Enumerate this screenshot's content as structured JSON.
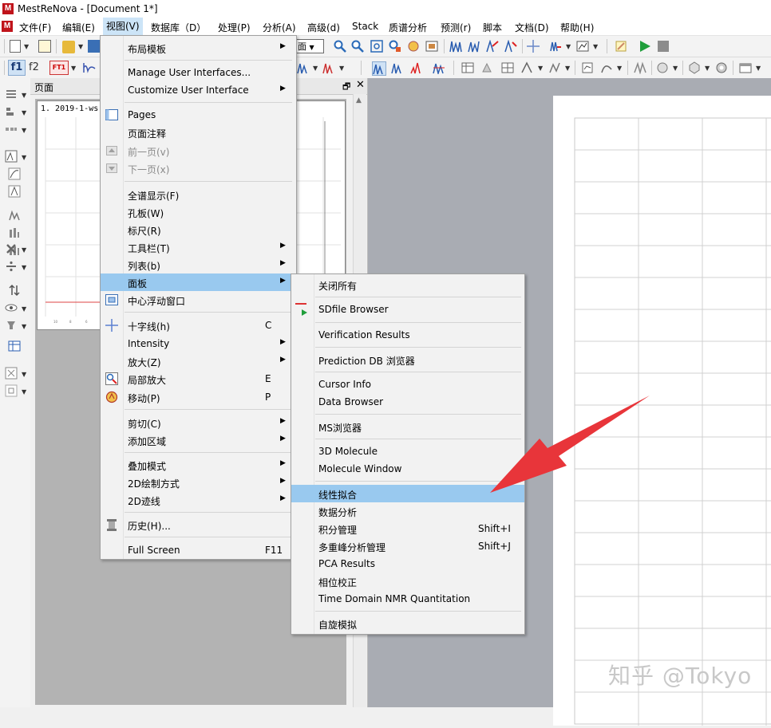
{
  "window": {
    "title": "MestReNova - [Document 1*]",
    "logo_letter": "M"
  },
  "menubar": {
    "items": [
      {
        "label": "文件(F)"
      },
      {
        "label": "编辑(E)"
      },
      {
        "label": "视图(V)"
      },
      {
        "label": "数据库（D）"
      },
      {
        "label": "处理(P)"
      },
      {
        "label": "分析(A)"
      },
      {
        "label": "高级(d)"
      },
      {
        "label": "Stack"
      },
      {
        "label": "质谱分析"
      },
      {
        "label": "预测(r)"
      },
      {
        "label": "脚本"
      },
      {
        "label": "文档(D)"
      },
      {
        "label": "帮助(H)"
      }
    ]
  },
  "toolbar2": {
    "f1": "f1",
    "f2": "f2",
    "ft1": "FT1"
  },
  "pages_panel": {
    "title": "页面",
    "thumb_label": "1. 2019-1-ws"
  },
  "view_menu": {
    "items": [
      {
        "label": "布局模板",
        "submenu": true
      },
      {
        "label": "Manage User Interfaces..."
      },
      {
        "label": "Customize User Interface",
        "submenu": true
      },
      {
        "label": "Pages",
        "icon": "pages-icon"
      },
      {
        "label": "页面注释"
      },
      {
        "label": "前一页(v)",
        "disabled": true,
        "icon": "prev-page-icon"
      },
      {
        "label": "下一页(x)",
        "disabled": true,
        "icon": "next-page-icon"
      },
      {
        "label": "全谱显示(F)"
      },
      {
        "label": "孔板(W)"
      },
      {
        "label": "标尺(R)"
      },
      {
        "label": "工具栏(T)",
        "submenu": true
      },
      {
        "label": "列表(b)",
        "submenu": true
      },
      {
        "label": "面板",
        "submenu": true,
        "highlighted": true
      },
      {
        "label": "中心浮动窗口",
        "icon": "float-window-icon"
      },
      {
        "label": "十字线(h)",
        "shortcut": "C",
        "icon": "crosshair-icon"
      },
      {
        "label": "Intensity",
        "submenu": true
      },
      {
        "label": "放大(Z)",
        "submenu": true
      },
      {
        "label": "局部放大",
        "shortcut": "E",
        "icon": "zoom-icon"
      },
      {
        "label": "移动(P)",
        "shortcut": "P",
        "icon": "pan-hand-icon"
      },
      {
        "label": "剪切(C)",
        "submenu": true
      },
      {
        "label": "添加区域",
        "submenu": true
      },
      {
        "label": "叠加模式",
        "submenu": true
      },
      {
        "label": "2D绘制方式",
        "submenu": true
      },
      {
        "label": "2D迹线",
        "submenu": true
      },
      {
        "label": "历史(H)...",
        "icon": "history-icon"
      },
      {
        "label": "Full Screen",
        "shortcut": "F11"
      }
    ]
  },
  "panel_submenu": {
    "items": [
      {
        "label": "关闭所有"
      },
      {
        "label": "SDfile Browser",
        "icon": "sdfile-icon"
      },
      {
        "label": "Verification Results"
      },
      {
        "label": "Prediction DB 浏览器"
      },
      {
        "label": "Cursor Info"
      },
      {
        "label": "Data Browser"
      },
      {
        "label": "MS浏览器"
      },
      {
        "label": "3D Molecule"
      },
      {
        "label": "Molecule Window"
      },
      {
        "label": "线性拟合",
        "highlighted": true
      },
      {
        "label": "数据分析"
      },
      {
        "label": "积分管理",
        "shortcut": "Shift+I"
      },
      {
        "label": "多重峰分析管理",
        "shortcut": "Shift+J"
      },
      {
        "label": "PCA Results"
      },
      {
        "label": "相位校正"
      },
      {
        "label": "Time Domain NMR Quantitation"
      },
      {
        "label": "自旋模拟"
      }
    ]
  },
  "watermark": "知乎 @Tokyo",
  "colors": {
    "highlight": "#99c9ef",
    "arrow": "#e8353a",
    "logo": "#c0141b"
  }
}
